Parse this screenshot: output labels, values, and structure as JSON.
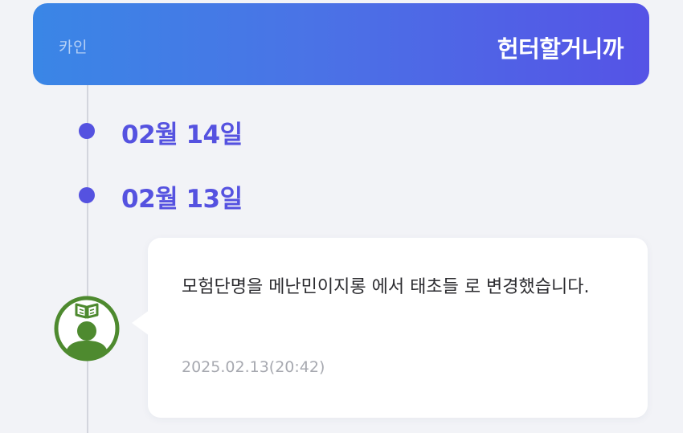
{
  "header": {
    "subtitle": "카인",
    "title": "헌터할거니까"
  },
  "timeline": {
    "dates": [
      {
        "label": "02월 14일"
      },
      {
        "label": "02월 13일"
      }
    ]
  },
  "entry": {
    "avatar_icon": "reader-book-icon",
    "message": "모험단명을 메난민이지롱 에서 태초들 로 변경했습니다.",
    "timestamp": "2025.02.13(20:42)"
  },
  "colors": {
    "accent": "#5552e0",
    "header_gradient_start": "#3a86e6",
    "header_gradient_end": "#5553e6",
    "avatar_green": "#4e8a2f",
    "background": "#f2f3f7"
  }
}
